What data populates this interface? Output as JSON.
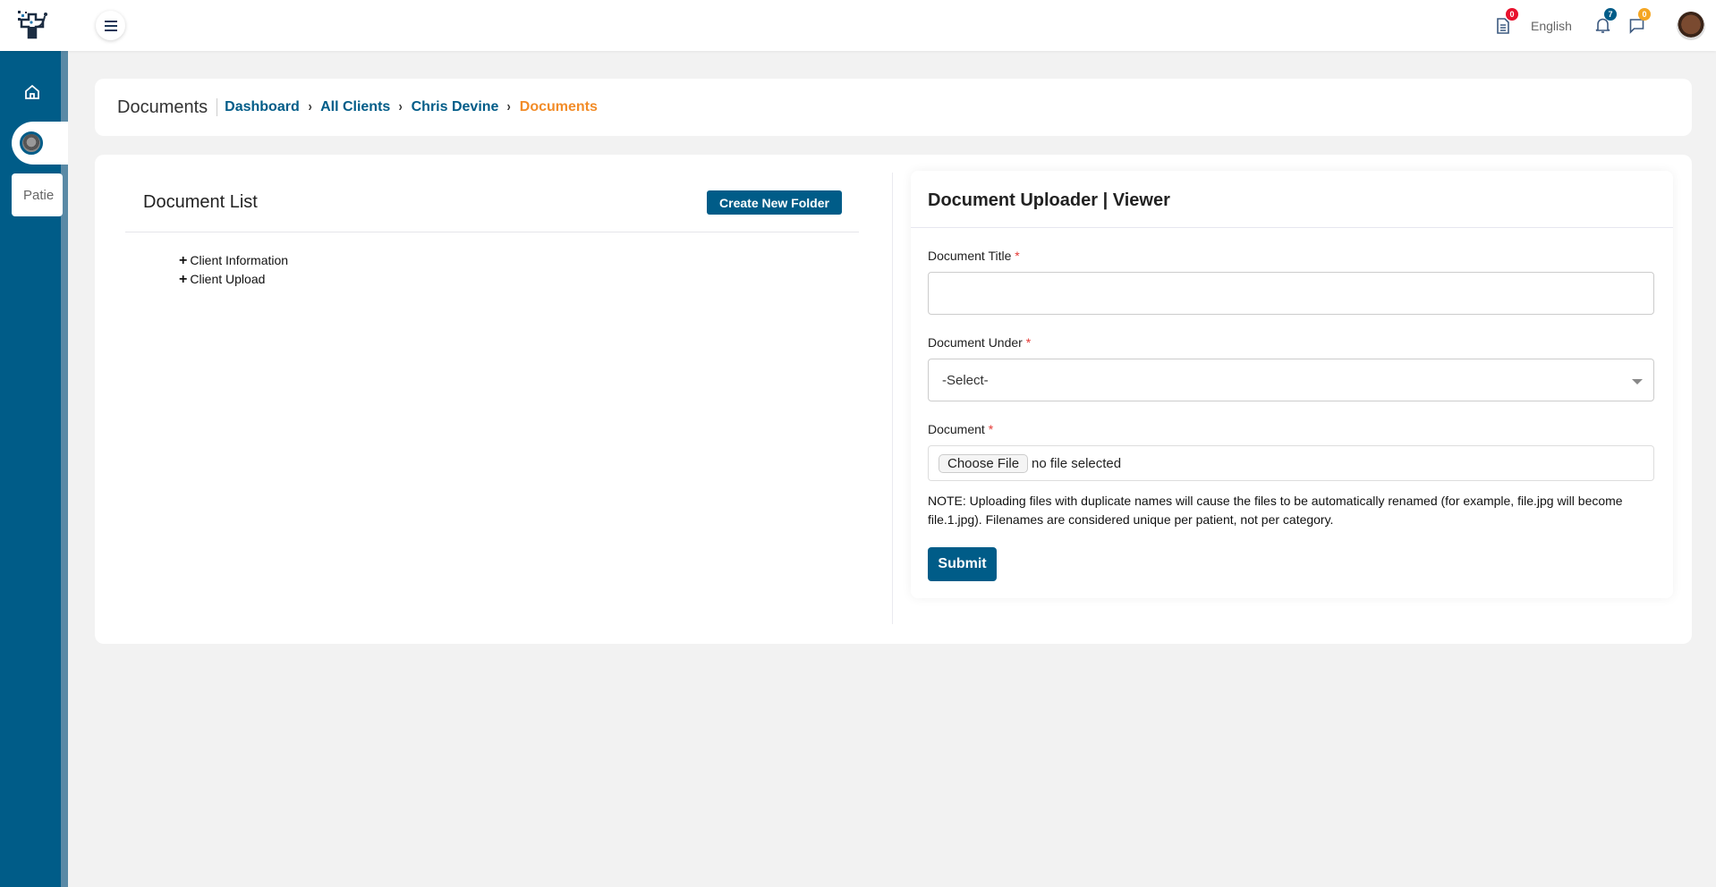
{
  "topbar": {
    "logo_icon": "clinic-logo-icon",
    "menu_icon": "hamburger-menu-icon",
    "documents_icon": "document-icon",
    "documents_badge": "0",
    "language": "English",
    "notifications_icon": "bell-icon",
    "notifications_badge": "7",
    "messages_icon": "chat-icon",
    "messages_badge": "0",
    "avatar": "user-avatar",
    "colors": {
      "red_badge": "#e8112d",
      "blue_badge": "#005c88",
      "orange_badge": "#f5a623"
    }
  },
  "sidebar": {
    "home_icon": "home-icon",
    "patient_avatar": "patient-avatar",
    "patient_label": "Patie",
    "color": "#005c88"
  },
  "breadcrumb": {
    "page_title": "Documents",
    "items": [
      "Dashboard",
      "All Clients",
      "Chris Devine"
    ],
    "current": "Documents",
    "separator_icon": "chevron-right-icon",
    "current_color": "#f28c28"
  },
  "document_list": {
    "title": "Document List",
    "create_button": "Create New Folder",
    "folders": [
      {
        "icon": "plus-icon",
        "label": "Client Information"
      },
      {
        "icon": "plus-icon",
        "label": "Client Upload"
      }
    ]
  },
  "uploader": {
    "title": "Document Uploader | Viewer",
    "fields": {
      "title_label": "Document Title",
      "title_value": "",
      "under_label": "Document Under",
      "under_selected": "-Select-",
      "document_label": "Document",
      "choose_file": "Choose File",
      "file_status": "no file selected",
      "required_mark": "*"
    },
    "note": "NOTE: Uploading files with duplicate names will cause the files to be automatically renamed (for example, file.jpg will become file.1.jpg). Filenames are considered unique per patient, not per category.",
    "submit": "Submit",
    "accent": "#005c88"
  }
}
